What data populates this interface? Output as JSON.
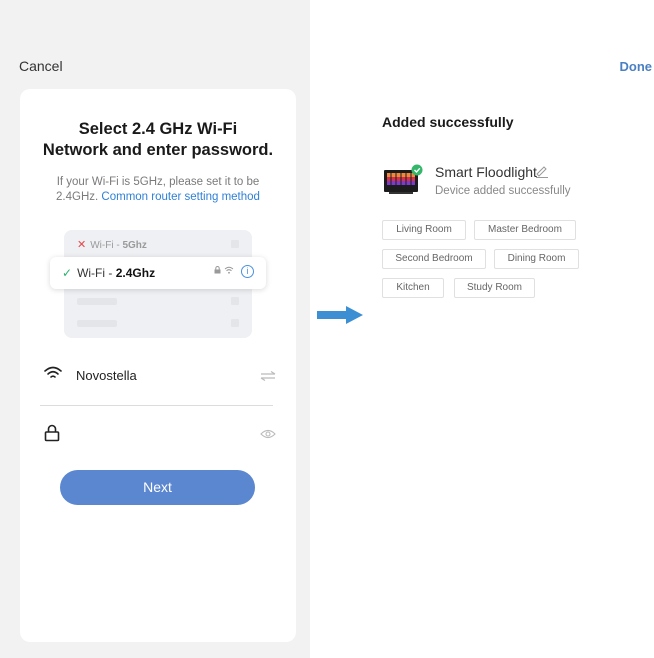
{
  "left": {
    "cancel_label": "Cancel",
    "title_line1": "Select 2.4 GHz Wi-Fi",
    "title_line2": "Network and enter password.",
    "desc_line1": "If your Wi-Fi is 5GHz, please set it to be",
    "desc_line2_prefix": "2.4GHz.",
    "desc_link": "Common router setting method",
    "illus": {
      "row5_prefix": "Wi-Fi - ",
      "row5_band": "5Ghz",
      "row24_prefix": "Wi-Fi - ",
      "row24_band": "2.4Ghz"
    },
    "ssid": "Novostella",
    "password_value": "",
    "next_label": "Next"
  },
  "right": {
    "done_label": "Done",
    "title": "Added successfully",
    "device_name": "Smart Floodlight",
    "device_status": "Device added successfully",
    "rooms": [
      "Living Room",
      "Master Bedroom",
      "Second Bedroom",
      "Dining Room",
      "Kitchen",
      "Study Room"
    ]
  },
  "colors": {
    "accent": "#2f80d6",
    "button": "#5a87cf",
    "done": "#4a7fc1",
    "success": "#27b36a",
    "error": "#e5484d",
    "arrow": "#3d8fd4"
  },
  "icons": [
    "close-icon",
    "check-icon",
    "lock-icon",
    "wifi-icon",
    "info-icon",
    "switch-network-icon",
    "eye-icon",
    "arrow-right-icon",
    "edit-icon",
    "success-check-icon"
  ]
}
